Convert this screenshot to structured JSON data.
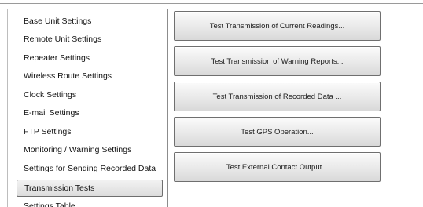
{
  "sidebar": {
    "items": [
      {
        "label": "Base Unit Settings"
      },
      {
        "label": "Remote Unit Settings"
      },
      {
        "label": "Repeater Settings"
      },
      {
        "label": "Wireless Route Settings"
      },
      {
        "label": "Clock Settings"
      },
      {
        "label": "E-mail Settings"
      },
      {
        "label": "FTP Settings"
      },
      {
        "label": "Monitoring / Warning Settings"
      },
      {
        "label": "Settings for Sending Recorded Data"
      },
      {
        "label": "Transmission Tests",
        "selected": true
      },
      {
        "label": "Settings Table"
      }
    ]
  },
  "tests": {
    "current_readings_label": "Test Transmission of Current Readings...",
    "warning_reports_label": "Test Transmission of Warning Reports...",
    "recorded_data_label": "Test Transmission of Recorded Data ...",
    "gps_label": "Test GPS Operation...",
    "external_contact_label": "Test External Contact Output..."
  }
}
